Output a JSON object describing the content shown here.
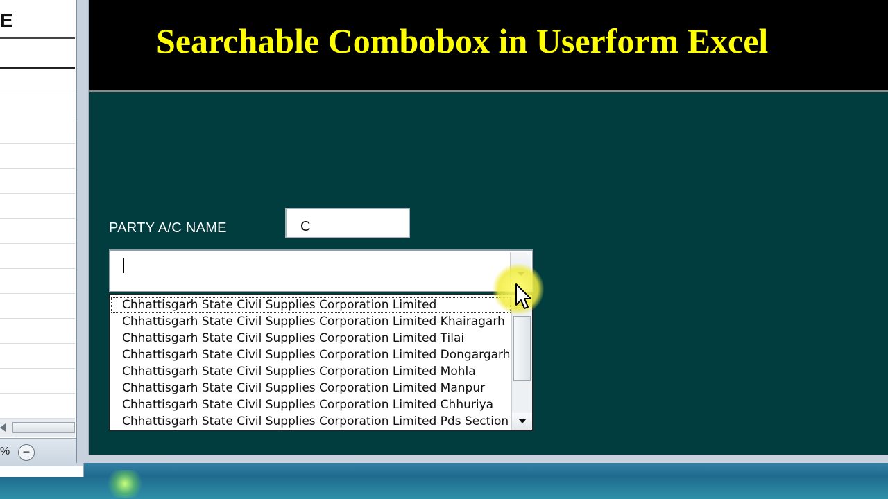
{
  "excel": {
    "column_letter": "E",
    "zoom_suffix": "%",
    "zoom_minus": "−"
  },
  "userform": {
    "title": "Searchable Combobox in Userform Excel",
    "party_label": "PARTY A/C NAME",
    "search_value": "C",
    "combo_value": "",
    "dropdown_items": [
      "Chhattisgarh State Civil Supplies Corporation Limited",
      "Chhattisgarh State Civil Supplies Corporation Limited Khairagarh",
      "Chhattisgarh State Civil Supplies Corporation Limited Tilai",
      "Chhattisgarh State Civil Supplies Corporation Limited Dongargarh",
      "Chhattisgarh State Civil Supplies Corporation Limited Mohla",
      "Chhattisgarh State Civil Supplies Corporation Limited Manpur",
      "Chhattisgarh State Civil Supplies Corporation Limited Chhuriya",
      "Chhattisgarh State Civil Supplies Corporation Limited Pds Section"
    ]
  },
  "colors": {
    "form_background": "#013d3e",
    "title_background": "#000000",
    "title_text": "#ffff00",
    "cursor_highlight": "#f0eb3c"
  },
  "icons": {
    "combo_dropdown": "chevron-down-icon",
    "scroll_up": "arrow-up-icon",
    "scroll_down": "arrow-down-icon",
    "mouse": "mouse-pointer-icon"
  }
}
